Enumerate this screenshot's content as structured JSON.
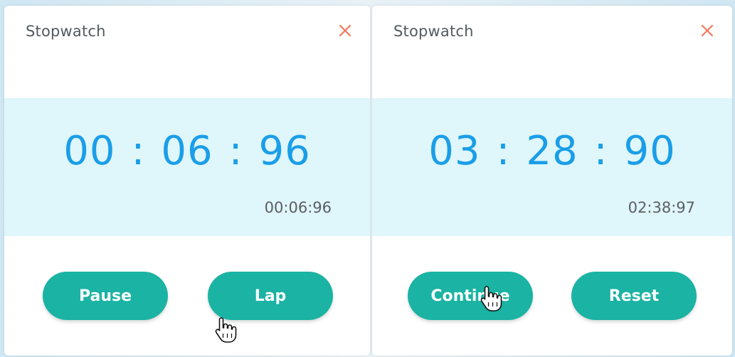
{
  "colors": {
    "accent": "#1bb3a3",
    "time_text": "#1a9ee8",
    "band": "#dff6fb",
    "close": "#f07a5a"
  },
  "left": {
    "title": "Stopwatch",
    "close_icon": "close-icon",
    "time": {
      "hours": "00",
      "minutes": "06",
      "seconds": "96",
      "sep": ":"
    },
    "lap_time": "00:06:96",
    "buttons": {
      "primary": "Pause",
      "secondary": "Lap"
    }
  },
  "right": {
    "title": "Stopwatch",
    "close_icon": "close-icon",
    "time": {
      "hours": "03",
      "minutes": "28",
      "seconds": "90",
      "sep": ":"
    },
    "lap_time": "02:38:97",
    "buttons": {
      "primary": "Continue",
      "secondary": "Reset"
    }
  },
  "cursor_icon": "hand-pointer-icon"
}
